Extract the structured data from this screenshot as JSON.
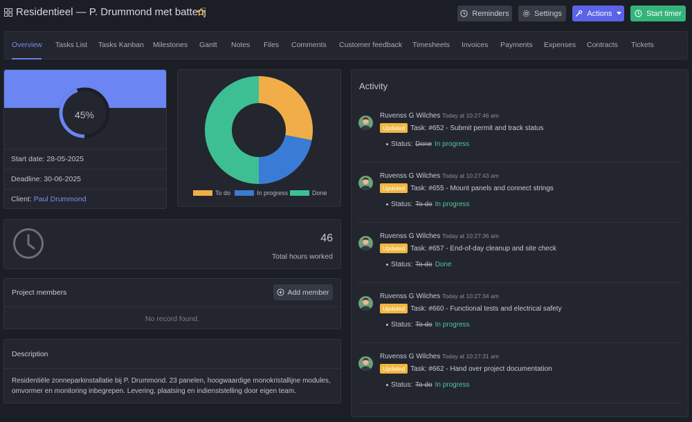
{
  "header": {
    "title": "Residentieel — P. Drummond met batterij",
    "buttons": {
      "reminders": "Reminders",
      "settings": "Settings",
      "actions": "Actions",
      "start_timer": "Start timer"
    }
  },
  "tabs": [
    {
      "label": "Overview",
      "active": true
    },
    {
      "label": "Tasks List"
    },
    {
      "label": "Tasks Kanban"
    },
    {
      "label": "Milestones"
    },
    {
      "label": "Gantt"
    },
    {
      "label": "Notes"
    },
    {
      "label": "Files"
    },
    {
      "label": "Comments"
    },
    {
      "label": "Customer feedback"
    },
    {
      "label": "Timesheets"
    },
    {
      "label": "Invoices"
    },
    {
      "label": "Payments"
    },
    {
      "label": "Expenses"
    },
    {
      "label": "Contracts"
    },
    {
      "label": "Tickets"
    }
  ],
  "progress": {
    "percent_label": "45%",
    "percent_value": 45,
    "start_label": "Start date:",
    "start_date": "28-05-2025",
    "deadline_label": "Deadline:",
    "deadline": "30-06-2025",
    "client_label": "Client:",
    "client": "Paul Drummond"
  },
  "chart_data": {
    "type": "pie",
    "categories": [
      "To do",
      "In progress",
      "Done"
    ],
    "values": [
      28,
      22,
      50
    ],
    "colors": [
      "#f1ad48",
      "#3a7bd5",
      "#3dbf93"
    ]
  },
  "hours": {
    "value": "46",
    "label": "Total hours worked"
  },
  "members": {
    "title": "Project members",
    "add_label": "Add member",
    "empty": "No record found."
  },
  "description": {
    "title": "Description",
    "text": "Residentiële zonneparkinstallatie bij P. Drummond. 23 panelen, hoogwaardige monokristallijne modules, omvormer en monitoring inbegrepen. Levering, plaatsing en indienststelling door eigen team."
  },
  "activity": {
    "title": "Activity",
    "badge": "Updated",
    "status_label": "Status:",
    "items": [
      {
        "user": "Ruvenss G Wilches",
        "time": "Today at 10:27:46 am",
        "task": "Task: #652 - Submit permit and track status",
        "old": "Done",
        "new": "In progress"
      },
      {
        "user": "Ruvenss G Wilches",
        "time": "Today at 10:27:43 am",
        "task": "Task: #655 - Mount panels and connect strings",
        "old": "To do",
        "new": "In progress"
      },
      {
        "user": "Ruvenss G Wilches",
        "time": "Today at 10:27:36 am",
        "task": "Task: #657 - End-of-day cleanup and site check",
        "old": "To do",
        "new": "Done"
      },
      {
        "user": "Ruvenss G Wilches",
        "time": "Today at 10:27:34 am",
        "task": "Task: #660 - Functional tests and electrical safety",
        "old": "To do",
        "new": "In progress"
      },
      {
        "user": "Ruvenss G Wilches",
        "time": "Today at 10:27:31 am",
        "task": "Task: #662 - Hand over project documentation",
        "old": "To do",
        "new": "In progress"
      }
    ]
  }
}
